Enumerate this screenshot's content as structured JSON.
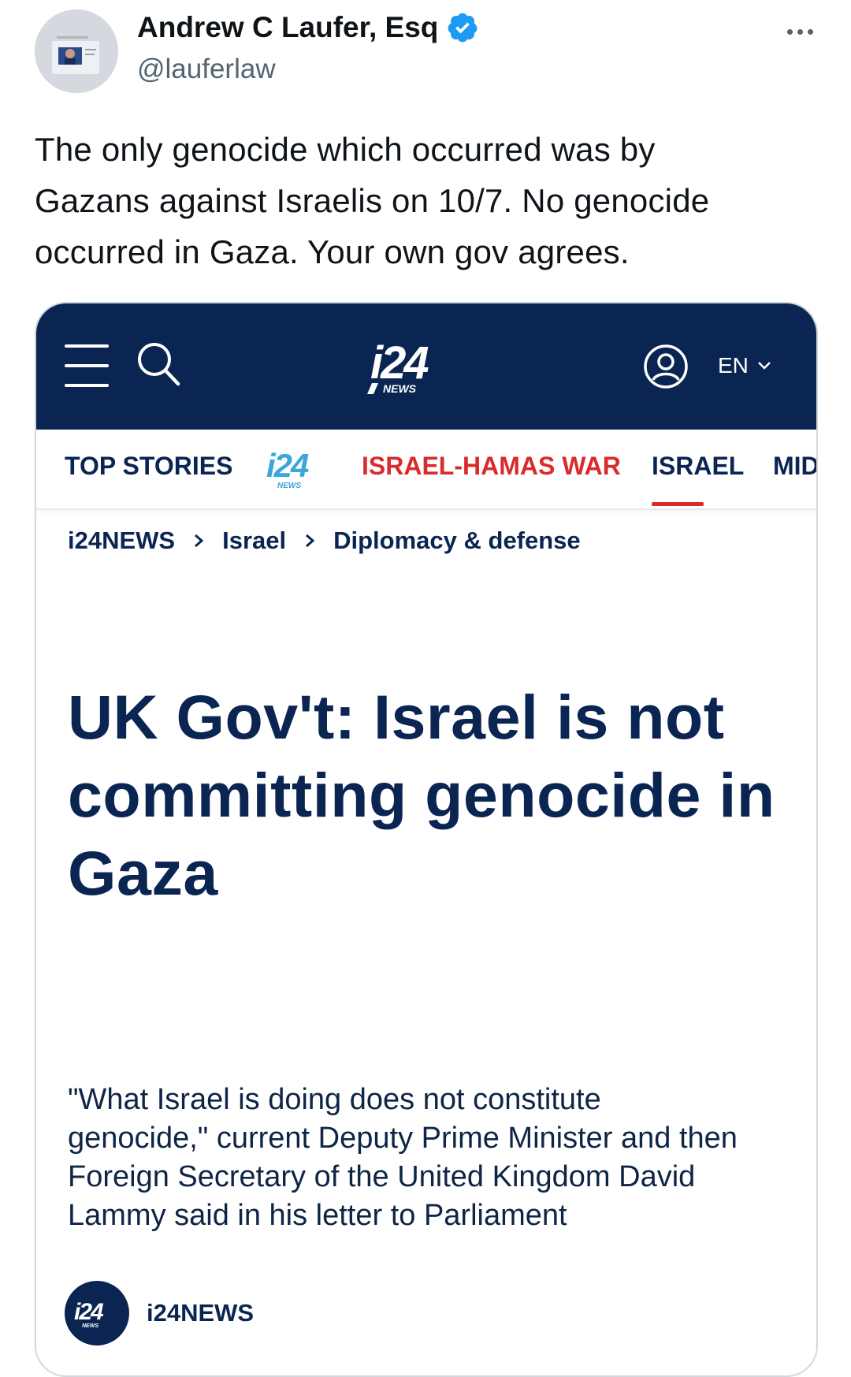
{
  "tweet": {
    "author_name": "Andrew C Laufer, Esq",
    "handle": "@lauferlaw",
    "verified": true,
    "text_lines": [
      "The only genocide which occurred was by",
      "Gazans against Israelis on 10/7.  No genocide",
      "occurred in Gaza.  Your own gov agrees."
    ],
    "icons": {
      "verified": "verified-badge-icon",
      "more": "more-options-icon"
    }
  },
  "card": {
    "header": {
      "logo_text": "i24",
      "logo_sub": "NEWS",
      "language": "EN",
      "icons": [
        "menu-icon",
        "search-icon",
        "user-icon",
        "chevron-down-icon"
      ]
    },
    "nav": {
      "top_stories": "TOP STORIES",
      "war": "ISRAEL-HAMAS WAR",
      "israel": "ISRAEL",
      "mid": "MID",
      "active": "ISRAEL"
    },
    "breadcrumb": [
      "i24NEWS",
      "Israel",
      "Diplomacy & defense"
    ],
    "headline_lines": [
      "UK Gov't: Israel is not",
      "committing genocide in",
      "Gaza"
    ],
    "lede_lines": [
      "\"What Israel is doing does not constitute",
      "genocide,\" current Deputy Prime Minister and then",
      "Foreign Secretary of the United Kingdom David",
      "Lammy said in his letter to Parliament"
    ],
    "source_name": "i24NEWS"
  },
  "colors": {
    "brand_navy": "#0b2553",
    "accent_red": "#d92b2b",
    "verified_blue": "#1d9bf0",
    "logo_teal": "#3aa6d9"
  }
}
